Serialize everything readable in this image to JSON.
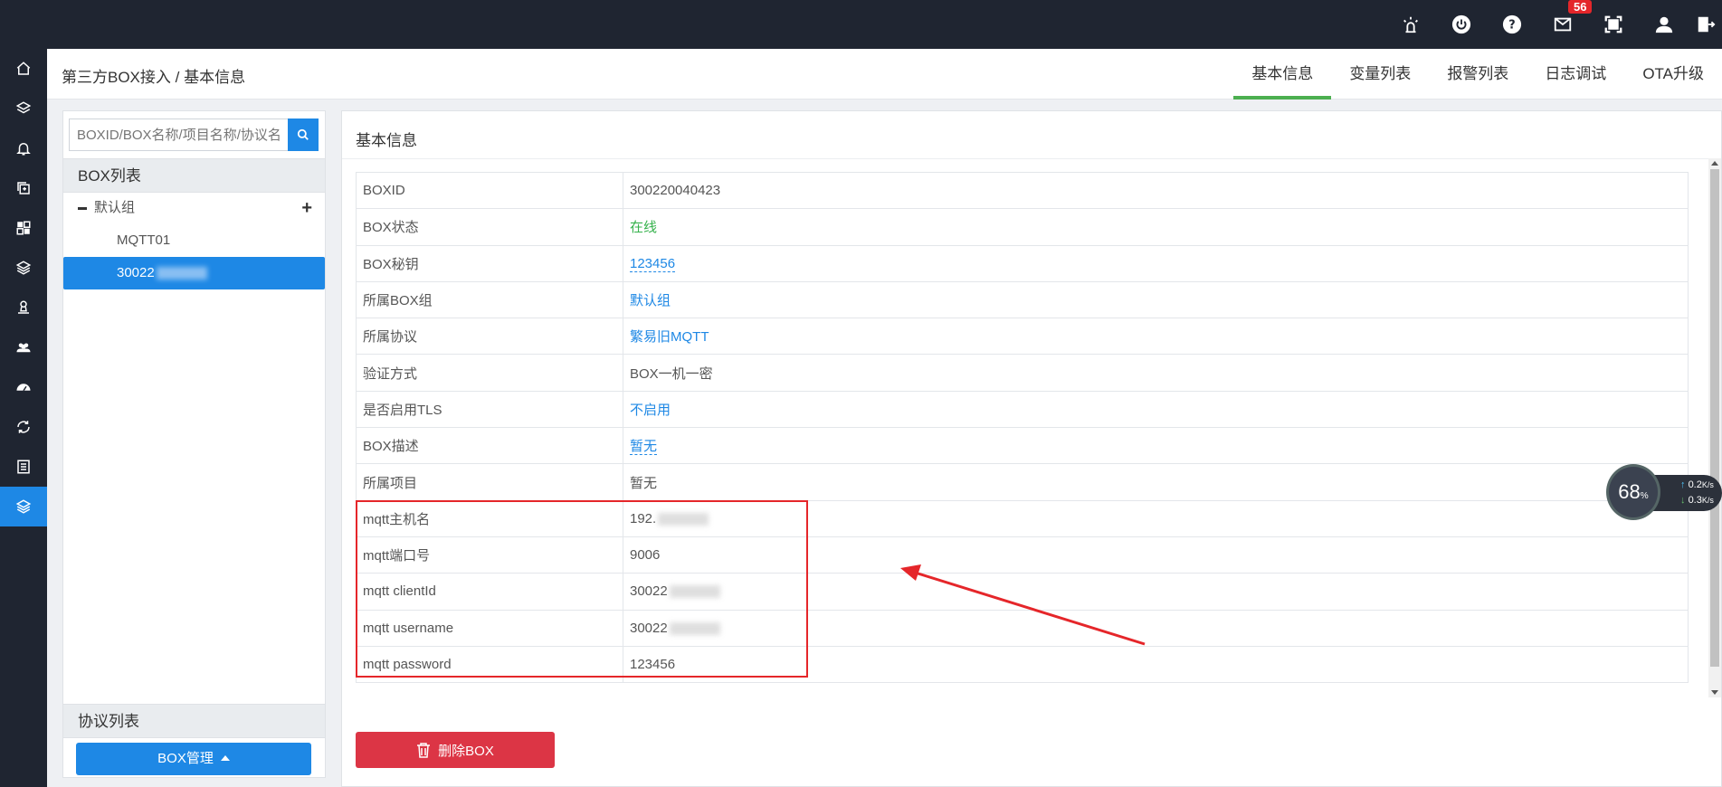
{
  "topbar": {
    "icons": [
      "alarm-light-icon",
      "power-icon",
      "help-icon",
      "mail-icon",
      "fullscreen-icon",
      "user-icon",
      "logout-icon"
    ],
    "mail_badge": "56"
  },
  "leftnav": {
    "icons": [
      "home-icon",
      "layers-icon",
      "bell-icon",
      "copy-icon",
      "dashboard-tiles-icon",
      "stack-icon",
      "user-stamp-icon",
      "group-icon",
      "gauge-icon",
      "refresh-icon",
      "list-icon",
      "layers-active-icon"
    ],
    "active_index": 11
  },
  "header": {
    "breadcrumb": "第三方BOX接入 / 基本信息",
    "tabs": [
      "基本信息",
      "变量列表",
      "报警列表",
      "日志调试",
      "OTA升级"
    ],
    "active_tab": 0
  },
  "left_panel": {
    "search_placeholder": "BOXID/BOX名称/项目名称/协议名",
    "box_list_title": "BOX列表",
    "group_name": "默认组",
    "boxes": [
      "MQTT01",
      "30022"
    ],
    "protocol_list_title": "协议列表",
    "box_mgmt_label": "BOX管理"
  },
  "main": {
    "title": "基本信息",
    "rows": [
      {
        "key": "BOXID",
        "value": "300220040423"
      },
      {
        "key": "BOX状态",
        "value": "在线"
      },
      {
        "key": "BOX秘钥",
        "value": "123456"
      },
      {
        "key": "所属BOX组",
        "value": "默认组"
      },
      {
        "key": "所属协议",
        "value": "繁易旧MQTT"
      },
      {
        "key": "验证方式",
        "value": "BOX一机一密"
      },
      {
        "key": "是否启用TLS",
        "value": "不启用"
      },
      {
        "key": "BOX描述",
        "value": "暂无"
      },
      {
        "key": "所属项目",
        "value": "暂无"
      },
      {
        "key": "mqtt主机名",
        "value": "192."
      },
      {
        "key": "mqtt端口号",
        "value": "9006"
      },
      {
        "key": "mqtt clientId",
        "value": "30022"
      },
      {
        "key": "mqtt username",
        "value": "30022"
      },
      {
        "key": "mqtt password",
        "value": "123456"
      }
    ],
    "delete_label": "删除BOX"
  },
  "speed_widget": {
    "percent": "68",
    "percent_unit": "%",
    "up": "0.2",
    "down": "0.3",
    "unit": "K/s"
  },
  "colors": {
    "topbar": "#1f2531",
    "accent": "#1e88e5",
    "status_online": "#37b24d",
    "danger": "#dc3545",
    "annotation": "#e5262a"
  }
}
